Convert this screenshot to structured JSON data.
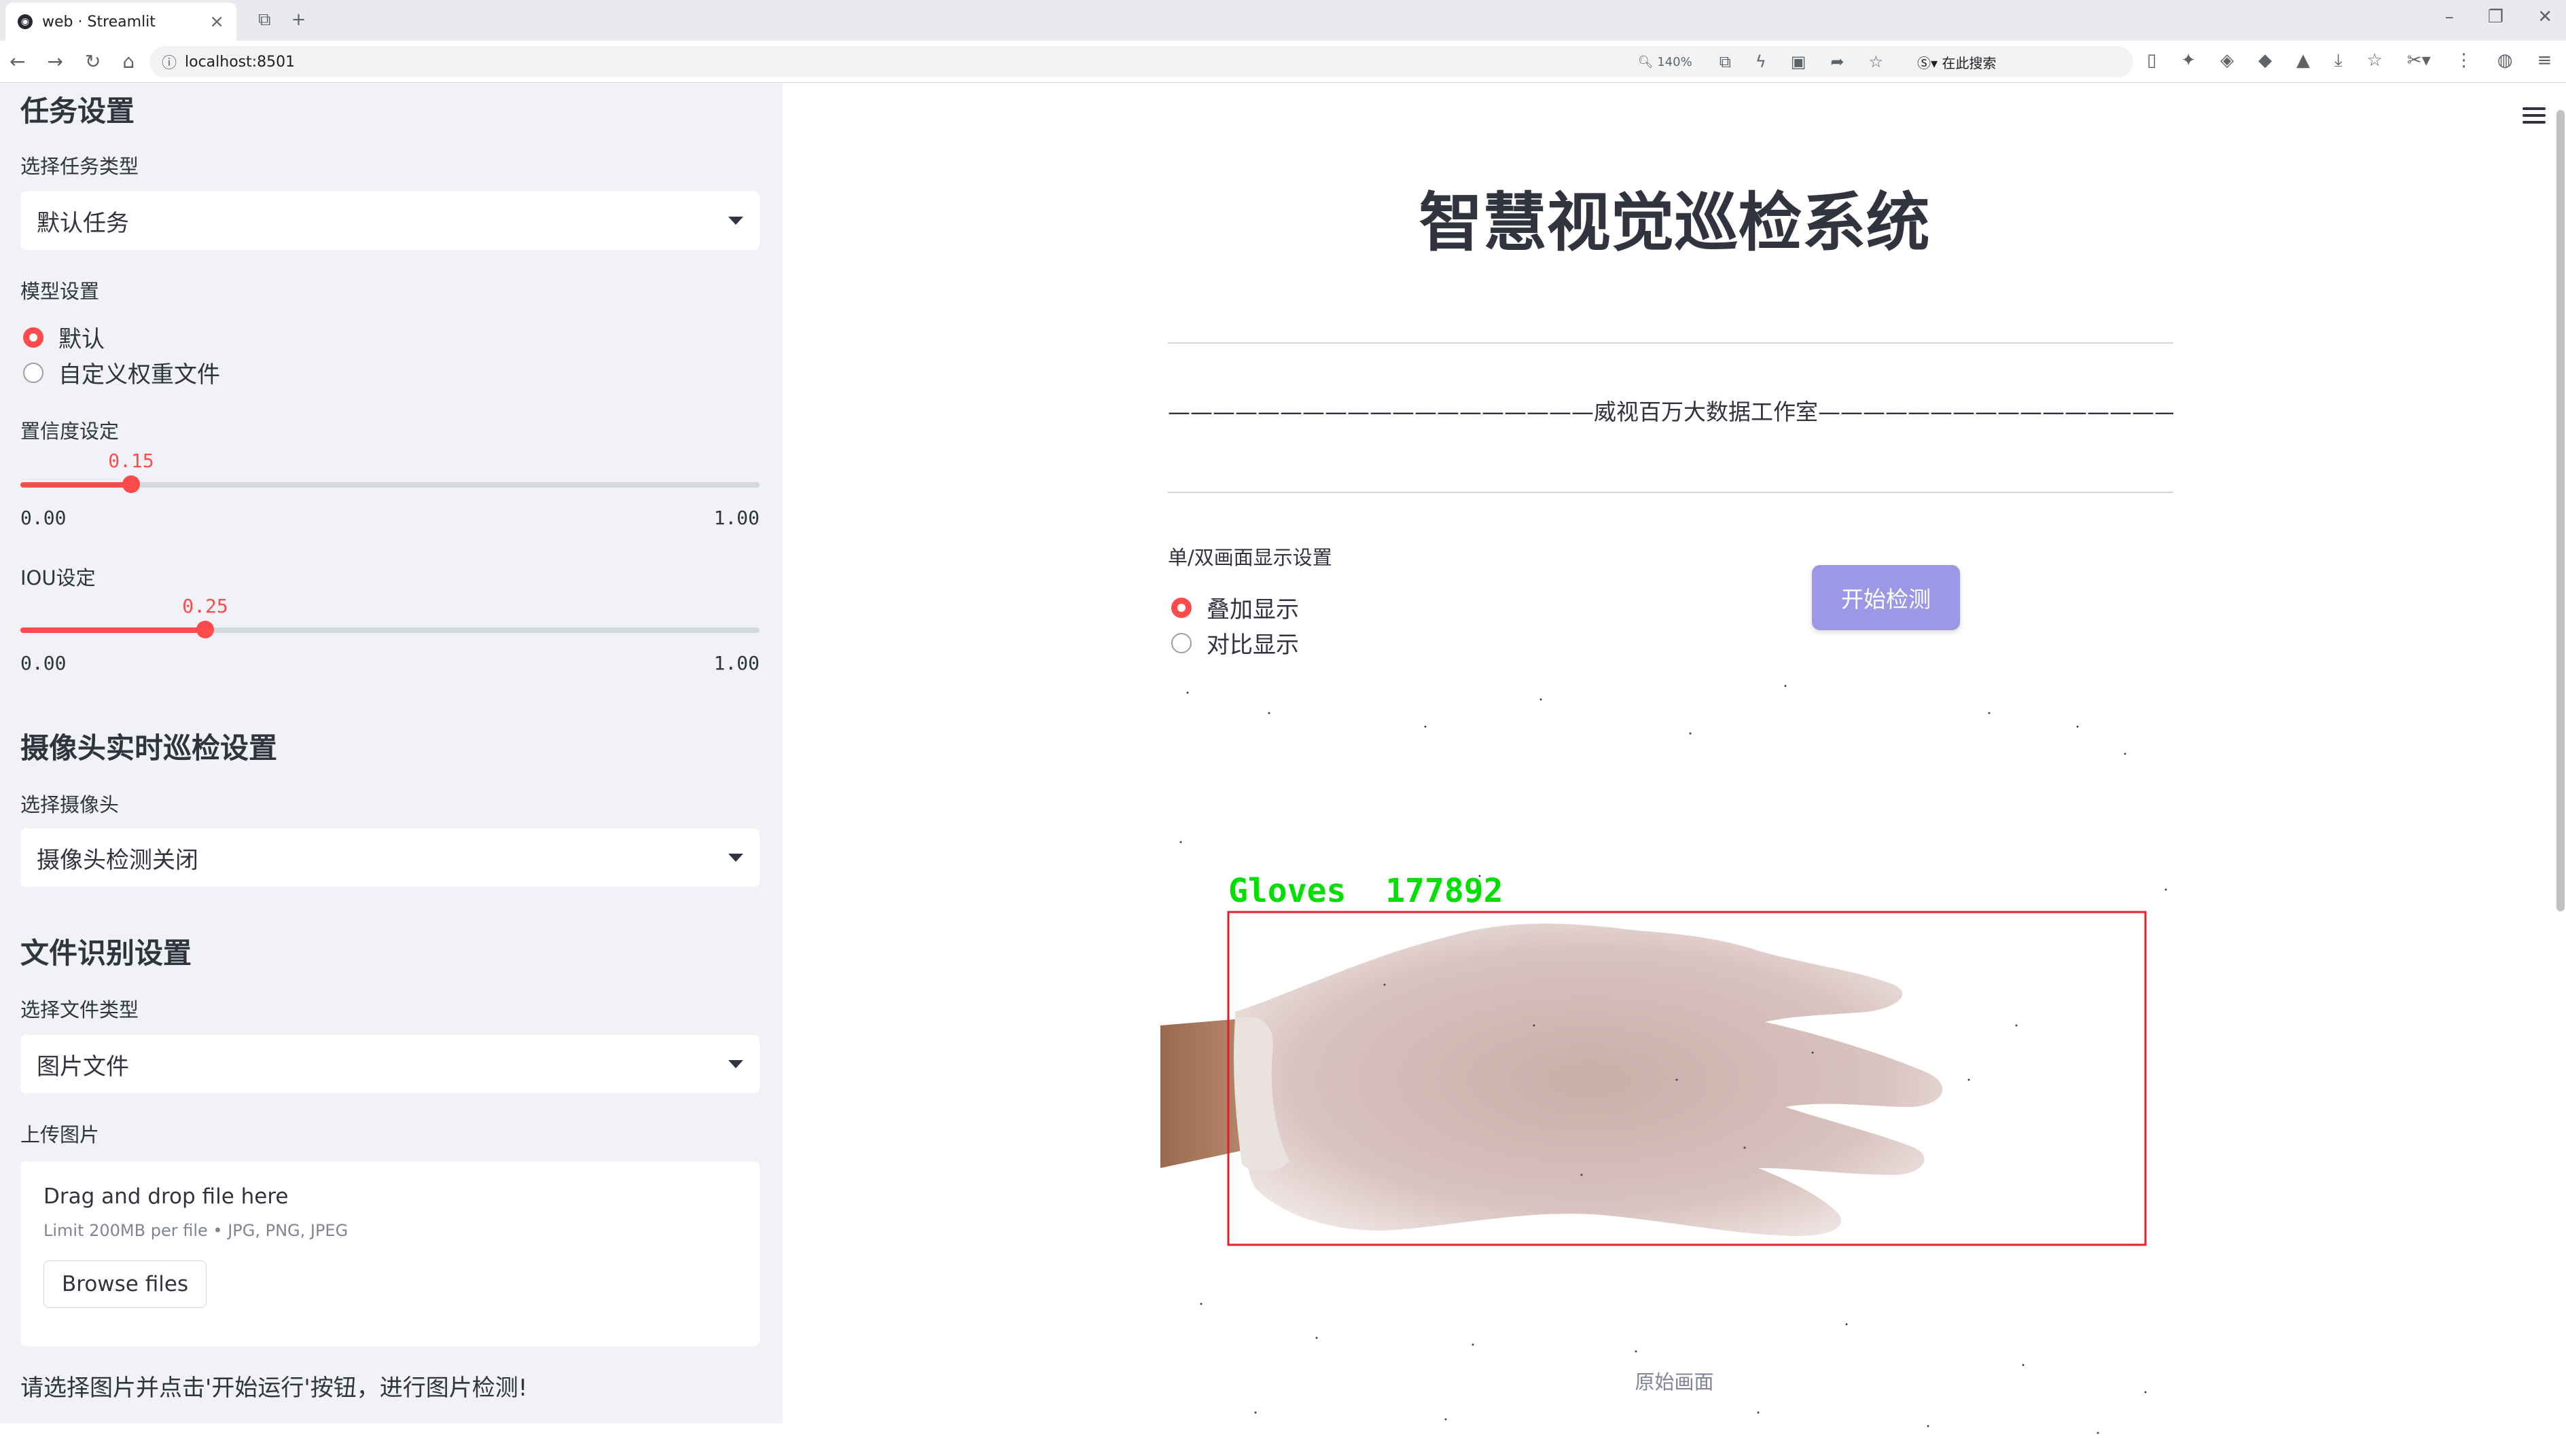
{
  "browser": {
    "tab_title": "web · Streamlit",
    "url": "localhost:8501",
    "zoom": "140%",
    "search_engine_label": "在此搜索"
  },
  "sidebar": {
    "task_section": "任务设置",
    "task_type_label": "选择任务类型",
    "task_type_value": "默认任务",
    "model_label": "模型设置",
    "model_options": [
      "默认",
      "自定义权重文件"
    ],
    "model_selected": "默认",
    "confidence": {
      "label": "置信度设定",
      "value": "0.15",
      "min": "0.00",
      "max": "1.00",
      "fraction": 0.15
    },
    "iou": {
      "label": "IOU设定",
      "value": "0.25",
      "min": "0.00",
      "max": "1.00",
      "fraction": 0.25
    },
    "camera_section": "摄像头实时巡检设置",
    "camera_label": "选择摄像头",
    "camera_value": "摄像头检测关闭",
    "file_section": "文件识别设置",
    "file_type_label": "选择文件类型",
    "file_type_value": "图片文件",
    "upload_label": "上传图片",
    "uploader": {
      "drag_text": "Drag and drop file here",
      "limit_text": "Limit 200MB per file • JPG, PNG, JPEG",
      "browse_label": "Browse files"
    },
    "footer_text": "请选择图片并点击'开始运行'按钮，进行图片检测!"
  },
  "main": {
    "title": "智慧视觉巡检系统",
    "studio_line": "———————————————————威视百万大数据工作室————————————————————",
    "display_label": "单/双画面显示设置",
    "display_options": [
      "叠加显示",
      "对比显示"
    ],
    "display_selected": "叠加显示",
    "start_button": "开始检测",
    "detection_label": "Gloves  177892",
    "image_caption": "原始画面"
  },
  "colors": {
    "accent": "#ff4b4b",
    "button": "#9c97e6",
    "sidebar_bg": "#f0f2f6",
    "box": "#e0202a",
    "label_green": "#00e000"
  }
}
